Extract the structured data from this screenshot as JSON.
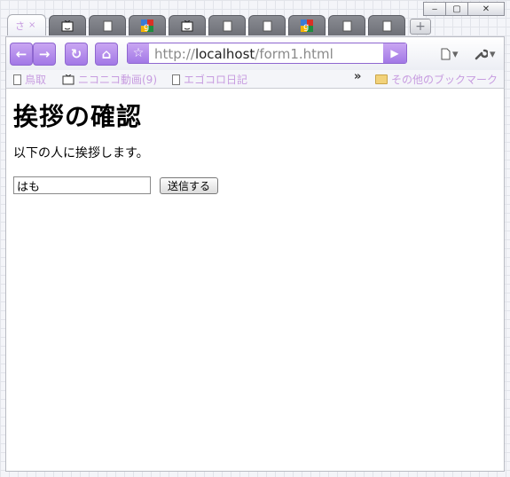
{
  "window": {
    "minimize_label": "‒",
    "maximize_label": "▢",
    "close_label": "✕"
  },
  "tabs": [
    {
      "title": "さ",
      "close": "×",
      "icon": "active-tab"
    },
    {
      "icon": "tv-icon"
    },
    {
      "icon": "page-icon"
    },
    {
      "icon": "google-icon"
    },
    {
      "icon": "tv-icon"
    },
    {
      "icon": "page-icon"
    },
    {
      "icon": "page-icon"
    },
    {
      "icon": "google-icon"
    },
    {
      "icon": "page-icon"
    },
    {
      "icon": "page-icon"
    }
  ],
  "toolbar": {
    "back": "←",
    "forward": "→",
    "reload": "↻",
    "home": "⌂",
    "star": "☆",
    "url_scheme": "http://",
    "url_host": "localhost",
    "url_path": "/form1.html",
    "go": "▶",
    "page_menu": "▾",
    "tools_menu": "▾"
  },
  "bookmarks": {
    "items": [
      {
        "label": "鳥取",
        "icon": "page-icon"
      },
      {
        "label": "ニコニコ動画(9)",
        "icon": "tv-icon"
      },
      {
        "label": "エゴコロ日記",
        "icon": "page-icon"
      }
    ],
    "overflow": "»",
    "other": "その他のブックマーク"
  },
  "page": {
    "heading": "挨拶の確認",
    "paragraph": "以下の人に挨拶します。",
    "name_value": "はも",
    "submit_label": "送信する"
  },
  "colors": {
    "accent": "#a278e6",
    "bookmark_text": "#c79ce0"
  }
}
